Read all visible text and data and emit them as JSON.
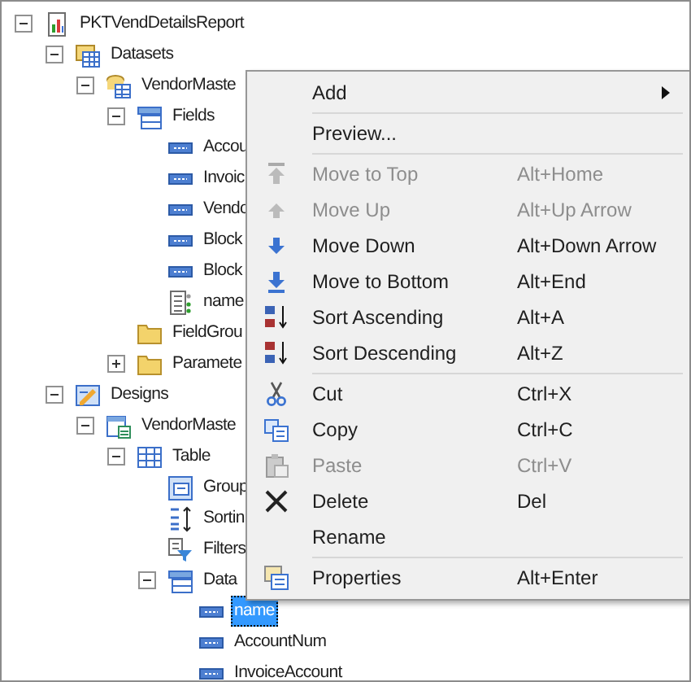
{
  "tree": [
    {
      "label": "PKTVendDetailsReport",
      "kind": "report",
      "expanded": true,
      "selected": false,
      "children": [
        {
          "label": "Datasets",
          "kind": "datasets",
          "expanded": true,
          "selected": false,
          "children": [
            {
              "label": "VendorMaste",
              "kind": "dataset",
              "expanded": true,
              "selected": false,
              "children": [
                {
                  "label": "Fields",
                  "kind": "fields",
                  "expanded": true,
                  "selected": false,
                  "children": [
                    {
                      "label": "Accou",
                      "kind": "field",
                      "selected": false
                    },
                    {
                      "label": "Invoic",
                      "kind": "field",
                      "selected": false
                    },
                    {
                      "label": "Vendo",
                      "kind": "field",
                      "selected": false
                    },
                    {
                      "label": "Block",
                      "kind": "field",
                      "selected": false
                    },
                    {
                      "label": "Block",
                      "kind": "field",
                      "selected": false
                    },
                    {
                      "label": "name",
                      "kind": "method",
                      "selected": false
                    }
                  ]
                },
                {
                  "label": "FieldGrou",
                  "kind": "folder",
                  "selected": false
                },
                {
                  "label": "Paramete",
                  "kind": "folder",
                  "expanded": false,
                  "selected": false
                }
              ]
            }
          ]
        },
        {
          "label": "Designs",
          "kind": "designs",
          "expanded": true,
          "selected": false,
          "children": [
            {
              "label": "VendorMaste",
              "kind": "design",
              "expanded": true,
              "selected": false,
              "children": [
                {
                  "label": "Table",
                  "kind": "table",
                  "expanded": true,
                  "selected": false,
                  "children": [
                    {
                      "label": "Group",
                      "kind": "groupings",
                      "selected": false
                    },
                    {
                      "label": "Sortin",
                      "kind": "sorting",
                      "selected": false
                    },
                    {
                      "label": "Filters",
                      "kind": "filters",
                      "selected": false
                    },
                    {
                      "label": "Data",
                      "kind": "fields",
                      "expanded": true,
                      "selected": false,
                      "children": [
                        {
                          "label": "name",
                          "kind": "field",
                          "selected": true
                        },
                        {
                          "label": "AccountNum",
                          "kind": "field",
                          "selected": false
                        },
                        {
                          "label": "InvoiceAccount",
                          "kind": "field",
                          "selected": false
                        }
                      ]
                    }
                  ]
                }
              ]
            }
          ]
        }
      ]
    }
  ],
  "context_menu": [
    {
      "kind": "plain",
      "label": "Add",
      "submenu": true,
      "disabled": false
    },
    {
      "kind": "separator"
    },
    {
      "kind": "plain",
      "label": "Preview...",
      "disabled": false
    },
    {
      "kind": "separator"
    },
    {
      "kind": "movetop",
      "label": "Move to Top",
      "shortcut": "Alt+Home",
      "disabled": true
    },
    {
      "kind": "moveup",
      "label": "Move Up",
      "shortcut": "Alt+Up Arrow",
      "disabled": true
    },
    {
      "kind": "movedown",
      "label": "Move Down",
      "shortcut": "Alt+Down Arrow",
      "disabled": false
    },
    {
      "kind": "movebottom",
      "label": "Move to Bottom",
      "shortcut": "Alt+End",
      "disabled": false
    },
    {
      "kind": "sortasc",
      "label": "Sort Ascending",
      "shortcut": "Alt+A",
      "disabled": false
    },
    {
      "kind": "sortdesc",
      "label": "Sort Descending",
      "shortcut": "Alt+Z",
      "disabled": false
    },
    {
      "kind": "separator"
    },
    {
      "kind": "cut",
      "label": "Cut",
      "shortcut": "Ctrl+X",
      "disabled": false
    },
    {
      "kind": "copy",
      "label": "Copy",
      "shortcut": "Ctrl+C",
      "disabled": false
    },
    {
      "kind": "paste",
      "label": "Paste",
      "shortcut": "Ctrl+V",
      "disabled": true
    },
    {
      "kind": "delete",
      "label": "Delete",
      "shortcut": "Del",
      "disabled": false
    },
    {
      "kind": "plain",
      "label": "Rename",
      "disabled": false
    },
    {
      "kind": "separator"
    },
    {
      "kind": "properties",
      "label": "Properties",
      "shortcut": "Alt+Enter",
      "disabled": false
    }
  ]
}
